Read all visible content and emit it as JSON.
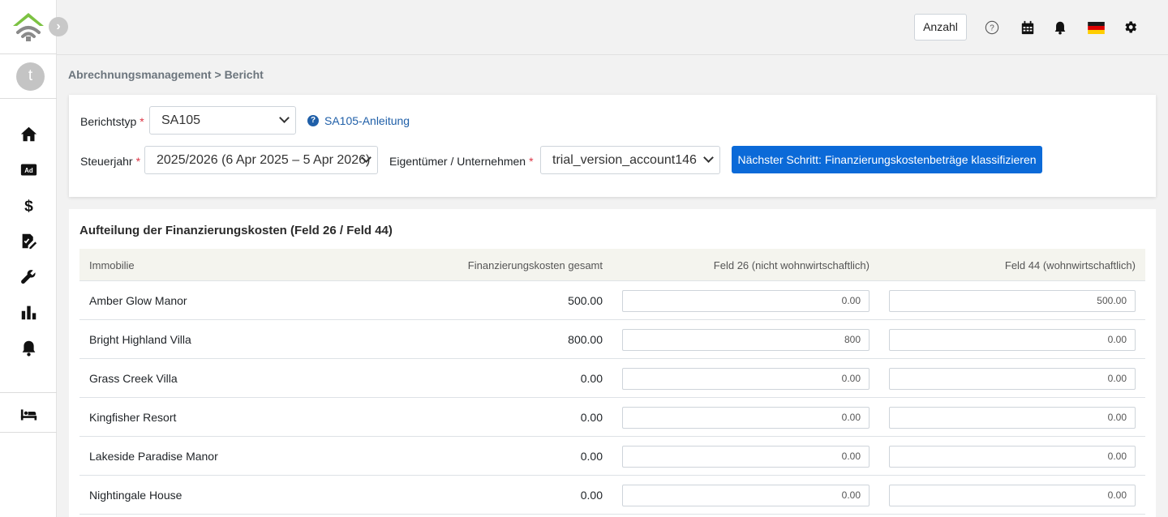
{
  "sidebar": {
    "collapse_glyph": "›",
    "avatar_initial": "t",
    "nav": [
      {
        "icon": "home-icon"
      },
      {
        "icon": "ad-icon",
        "label": "Ad"
      },
      {
        "icon": "dollar-icon",
        "label": "$"
      },
      {
        "icon": "edit-document-icon"
      },
      {
        "icon": "wrench-icon"
      },
      {
        "icon": "bar-chart-icon"
      },
      {
        "icon": "bell-icon"
      },
      {
        "icon": "bed-icon"
      }
    ]
  },
  "topbar": {
    "count_button": "Anzahl",
    "icons": [
      "help-icon",
      "calendar-icon",
      "bell-icon",
      "german-flag-icon",
      "gear-icon"
    ]
  },
  "breadcrumb": {
    "parent": "Abrechnungsmanagement",
    "separator": " > ",
    "current": "Bericht"
  },
  "filters": {
    "report_type_label": "Berichtstyp",
    "report_type_value": "SA105",
    "help_link": "SA105-Anleitung",
    "tax_year_label": "Steuerjahr",
    "tax_year_value": "2025/2026 (6 Apr 2025 – 5 Apr 2026)",
    "owner_label": "Eigentümer / Unternehmen",
    "owner_value": "trial_version_account146",
    "required_mark": "*",
    "next_button": "Nächster Schritt: Finanzierungskostenbeträge klassifizieren"
  },
  "table": {
    "title": "Aufteilung der Finanzierungskosten (Feld 26 / Feld 44)",
    "columns": [
      "Immobilie",
      "Finanzierungskosten gesamt",
      "Feld 26 (nicht wohnwirtschaftlich)",
      "Feld 44 (wohnwirtschaftlich)"
    ],
    "rows": [
      {
        "property": "Amber Glow Manor",
        "total": "500.00",
        "box26": "0.00",
        "box44": "500.00"
      },
      {
        "property": "Bright Highland Villa",
        "total": "800.00",
        "box26": "800",
        "box44": "0.00"
      },
      {
        "property": "Grass Creek Villa",
        "total": "0.00",
        "box26": "0.00",
        "box44": "0.00"
      },
      {
        "property": "Kingfisher Resort",
        "total": "0.00",
        "box26": "0.00",
        "box44": "0.00"
      },
      {
        "property": "Lakeside Paradise Manor",
        "total": "0.00",
        "box26": "0.00",
        "box44": "0.00"
      },
      {
        "property": "Nightingale House",
        "total": "0.00",
        "box26": "0.00",
        "box44": "0.00"
      }
    ]
  },
  "colors": {
    "primary": "#0b6ad8",
    "link": "#1f5fa8",
    "required": "#dc3545",
    "logo_green": "#7cc242",
    "logo_gray": "#8a8a8a"
  }
}
